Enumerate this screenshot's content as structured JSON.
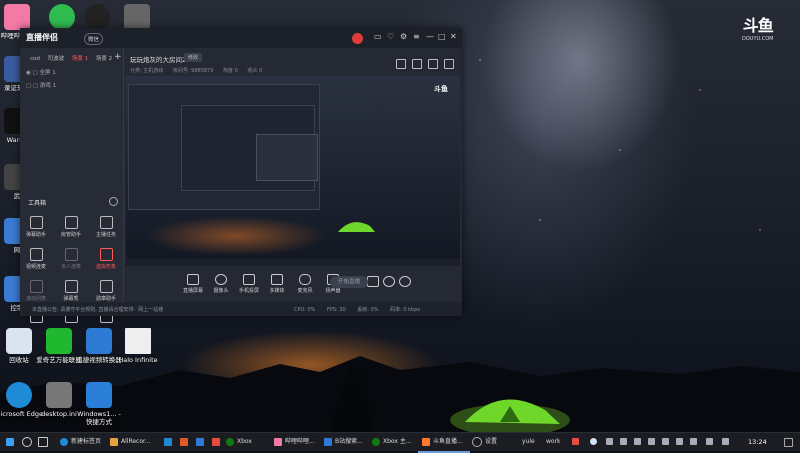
{
  "desktop_icons": [
    {
      "label": "哔哩哔哩工",
      "icon": "bilibili-icon",
      "color": "#f47aa6"
    },
    {
      "label": "",
      "icon": "wechat-icon",
      "color": "#2ebc4f"
    },
    {
      "label": "",
      "icon": "qq-icon",
      "color": "#222"
    },
    {
      "label": "",
      "icon": "file-icon",
      "color": "#666"
    },
    {
      "label": "录证软件",
      "icon": "app-icon",
      "color": "#3a5ba0"
    },
    {
      "label": "Warne",
      "icon": "app-icon",
      "color": "#111"
    },
    {
      "label": "武",
      "icon": "app-icon",
      "color": "#444"
    },
    {
      "label": "网",
      "icon": "app-icon",
      "color": "#3a7bd5"
    },
    {
      "label": "控制",
      "icon": "control-panel-icon",
      "color": "#3a7bd5"
    },
    {
      "label": "回收站",
      "icon": "recycle-bin-icon",
      "color": "#d9e4f0"
    },
    {
      "label": "爱奇艺万能联播",
      "icon": "iqiyi-icon",
      "color": "#1fb82f"
    },
    {
      "label": "迅捷视频转换器",
      "icon": "video-converter-icon",
      "color": "#2e7bd6"
    },
    {
      "label": "Halo Infinite",
      "icon": "document-icon",
      "color": "#eee"
    },
    {
      "label": "Microsoft Edge",
      "icon": "edge-icon",
      "color": "#1f8ad6"
    },
    {
      "label": "desktop.ini",
      "icon": "ini-file-icon",
      "color": "#777"
    },
    {
      "label": "Windows1... - 快捷方式",
      "icon": "windows-icon",
      "color": "#2c7fd6"
    }
  ],
  "douyu": {
    "mark": "斗鱼",
    "sub": "DOUYU.COM"
  },
  "window": {
    "brand": "直播伴侣",
    "version_badge": "微信",
    "tabs": [
      "cod",
      "司波波",
      "场景 1",
      "场景 2"
    ],
    "active_tab_index": 2,
    "scene_items": [
      "全屏 1",
      "游戏 1"
    ],
    "tools_title": "工具箱",
    "tools": [
      {
        "label": "弹幕助手",
        "state": "normal"
      },
      {
        "label": "房管助手",
        "state": "normal"
      },
      {
        "label": "主播任务",
        "state": "normal"
      },
      {
        "label": "视频连麦",
        "state": "normal"
      },
      {
        "label": "多人连麦",
        "state": "dim"
      },
      {
        "label": "虚拟形象",
        "state": "red"
      },
      {
        "label": "滚动列表",
        "state": "dim"
      },
      {
        "label": "弹幕秀",
        "state": "normal"
      },
      {
        "label": "勋章助手",
        "state": "normal"
      },
      {
        "label": "",
        "state": "normal"
      },
      {
        "label": "",
        "state": "normal"
      },
      {
        "label": "",
        "state": "normal"
      }
    ],
    "room_title": "玩玩炮灰的大房间2",
    "room_tag": "修改",
    "room_sub": [
      "分类: 主机游戏",
      "房间号: 9885879",
      "热度 0",
      "观众 0"
    ],
    "preview_logo": "斗鱼",
    "controls": [
      "直播屏幕",
      "摄像头",
      "手机投屏",
      "多媒体",
      "麦克风",
      "扬声器"
    ],
    "go_live_label": "开始直播",
    "status_message": "本直播公告: 请遵守平台规则, 直播请合理安排 · 网上一站链",
    "status_metrics": [
      "CPU: 0%",
      "FPS: 30",
      "丢帧: 0%",
      "码率: 0 kbps"
    ]
  },
  "taskbar": {
    "items": [
      {
        "label": "新建标签页",
        "color": "#1f8ad6"
      },
      {
        "label": "AllRecor...",
        "color": "#e6a23c"
      },
      {
        "label": "",
        "color": "#1f8ad6"
      },
      {
        "label": "",
        "color": "#e05a2b"
      },
      {
        "label": "",
        "color": "#2e7bd6"
      },
      {
        "label": "Xbox",
        "color": "#107c10"
      },
      {
        "label": "哔哩哔哩...",
        "color": "#f47aa6"
      },
      {
        "label": "B站搜索...",
        "color": "#2e7bd6"
      },
      {
        "label": "Xbox 主...",
        "color": "#107c10"
      },
      {
        "label": "斗鱼直播...",
        "color": "#ff7a2e"
      },
      {
        "label": "设置",
        "color": "#888"
      }
    ],
    "tray_text": [
      "yule",
      "work"
    ],
    "time": "13:24"
  }
}
